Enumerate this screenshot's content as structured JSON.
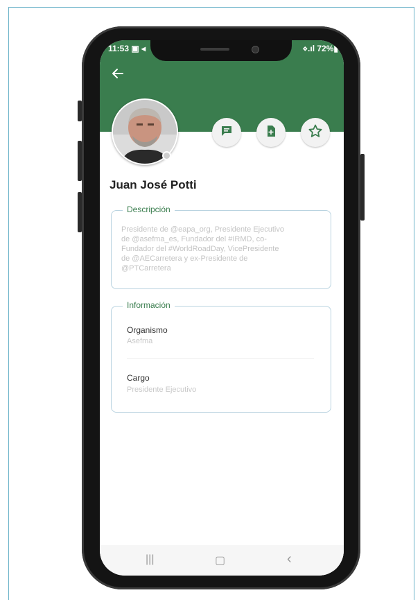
{
  "status_bar": {
    "time": "11:53 ▣ ◂",
    "right": "⋄.ıl 72%▮"
  },
  "profile": {
    "name": "Juan José Potti"
  },
  "description": {
    "title": "Descripción",
    "text": "Presidente de @eapa_org, Presidente Ejecutivo de @asefma_es, Fundador del #IRMD, co-Fundador del #WorldRoadDay, VicePresidente de @AECarretera y ex-Presidente de @PTCarretera"
  },
  "information": {
    "title": "Información",
    "fields": [
      {
        "label": "Organismo",
        "value": "Asefma"
      },
      {
        "label": "Cargo",
        "value": "Presidente Ejecutivo"
      }
    ]
  },
  "icons": {
    "back": "arrow-left",
    "chat": "chat-icon",
    "document": "add-document-icon",
    "favorite": "star-icon"
  },
  "nav": {
    "recent": "|||",
    "home": "▢",
    "back": "‹"
  },
  "colors": {
    "header": "#3a7d4e",
    "accent": "#3a7d4e",
    "card_border": "#b9d3e0"
  }
}
